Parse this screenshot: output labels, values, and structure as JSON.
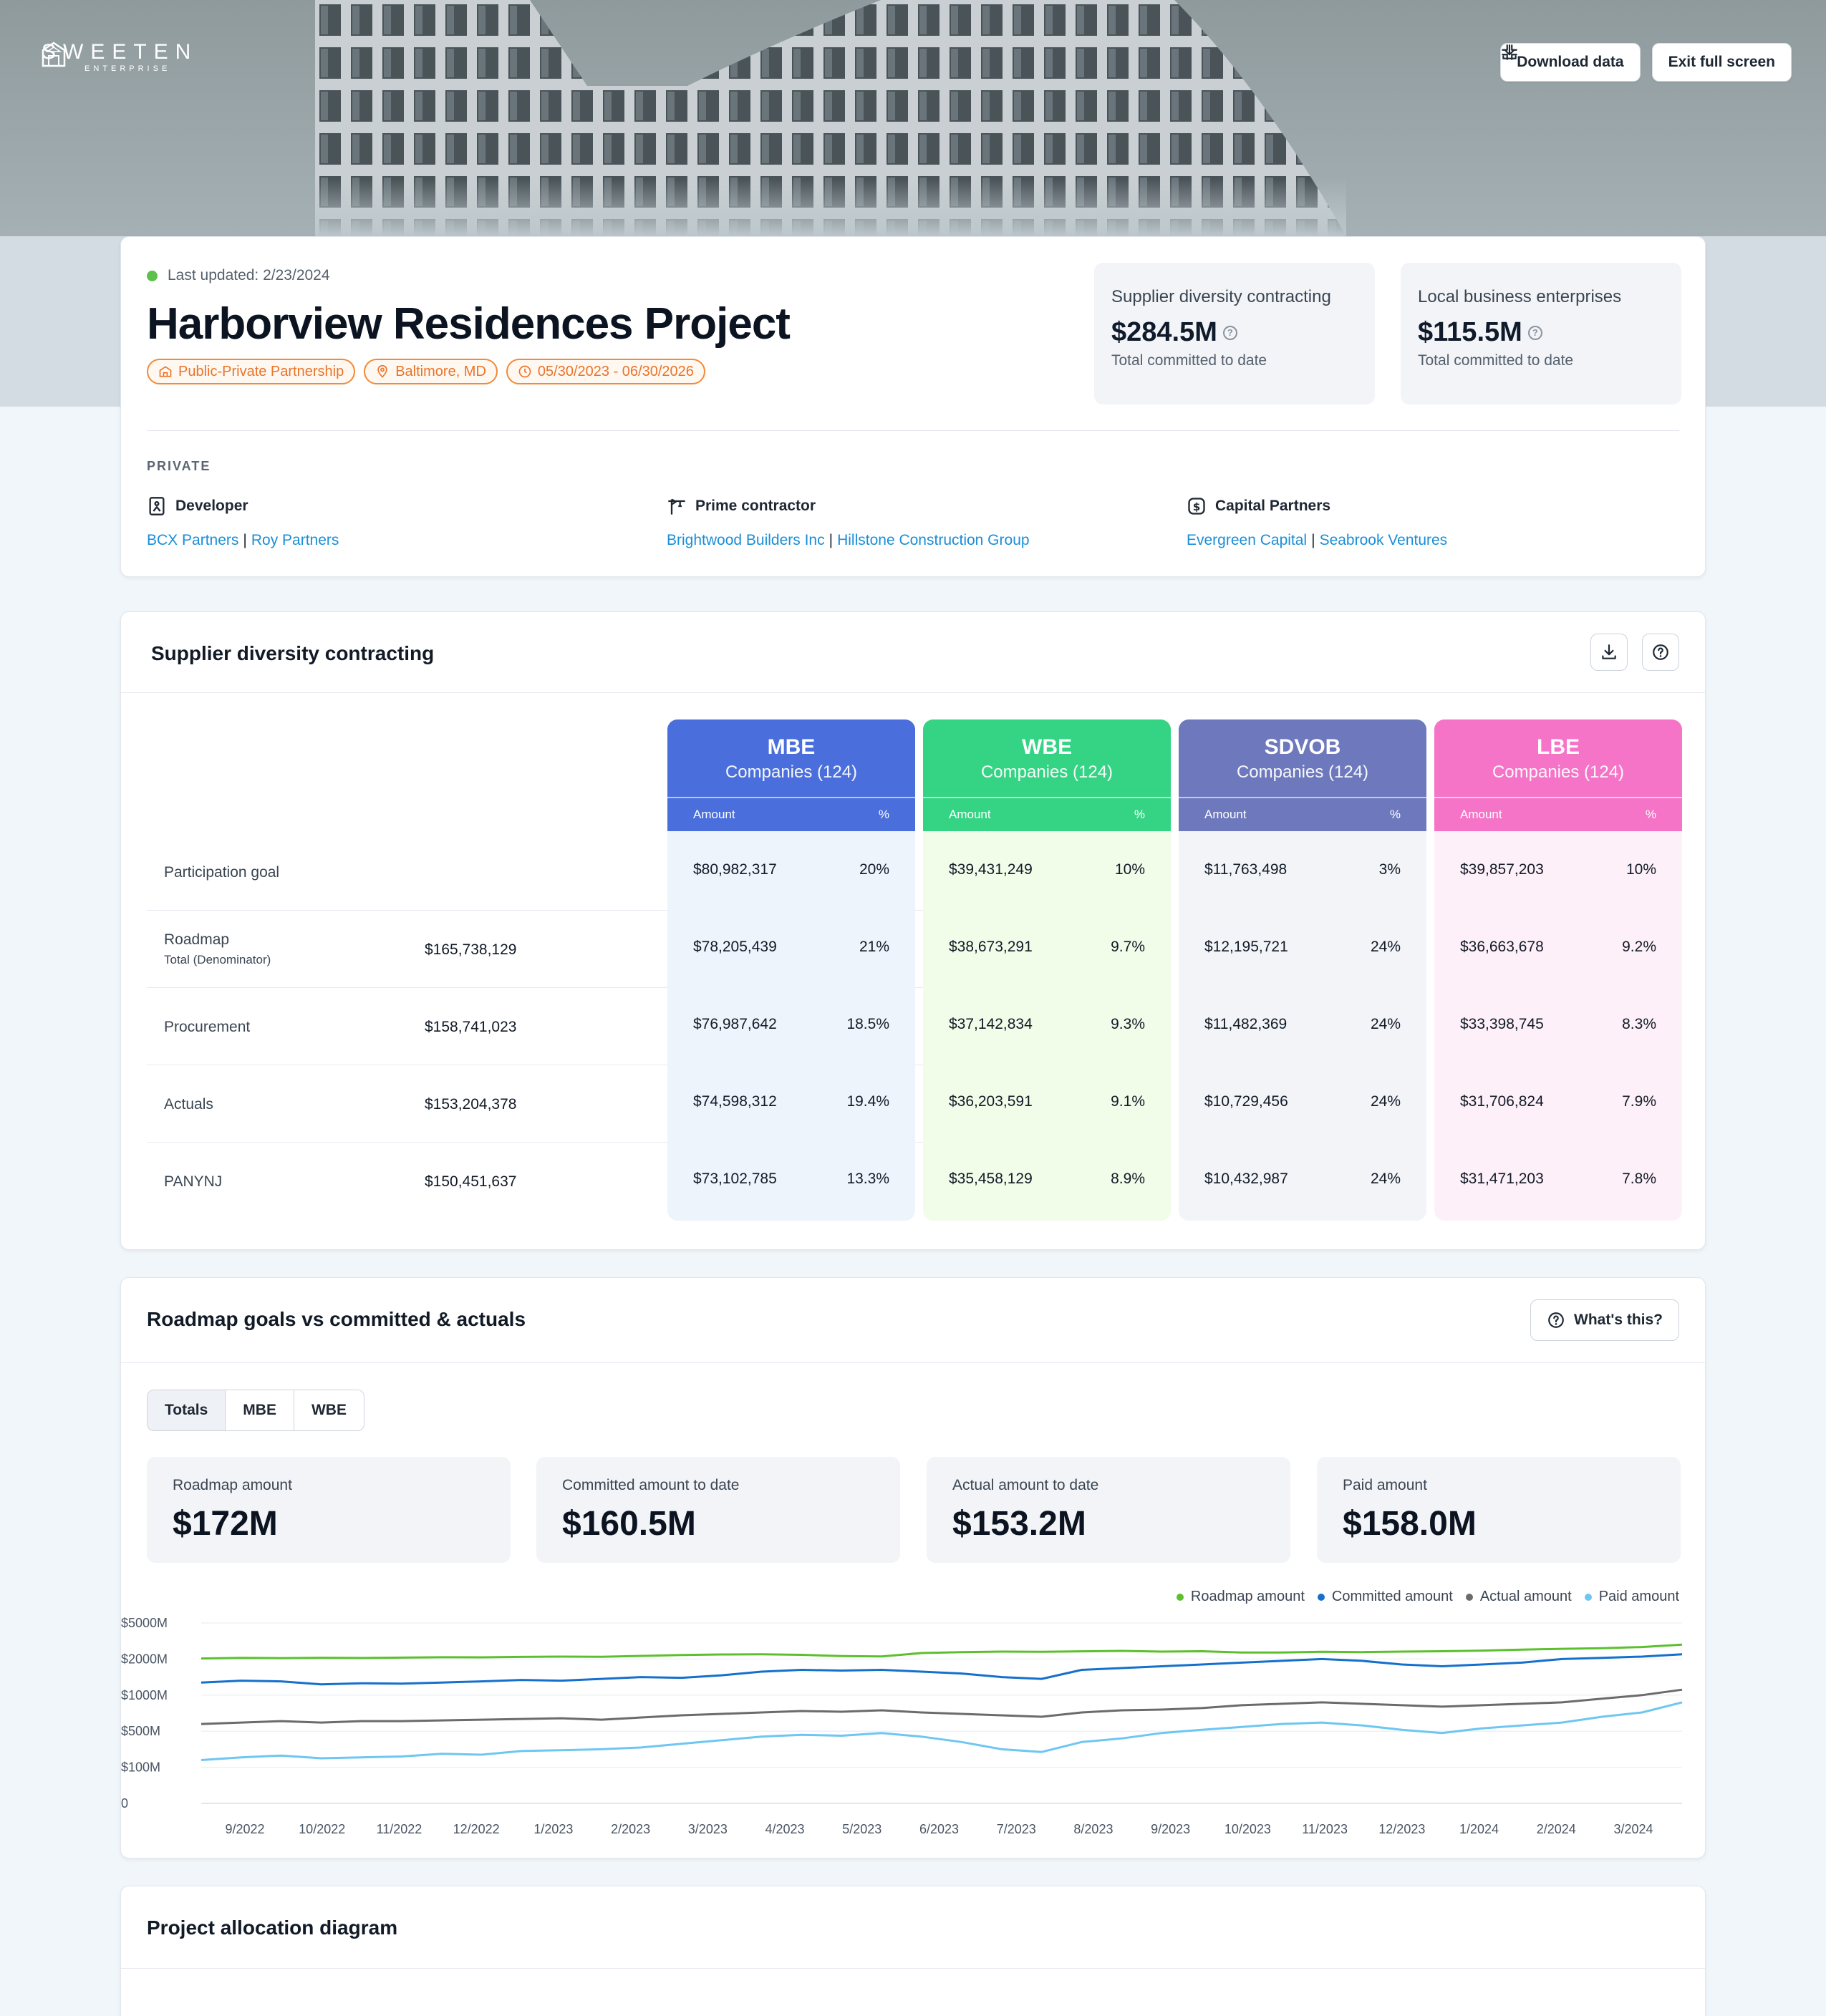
{
  "brand": {
    "name": "SWEETEN",
    "sub": "ENTERPRISE"
  },
  "hero_buttons": {
    "download": "Download data",
    "exit": "Exit full screen"
  },
  "project": {
    "last_updated": "Last updated: 2/23/2024",
    "title": "Harborview Residences Project",
    "tags": [
      "Public-Private Partnership",
      "Baltimore, MD",
      "05/30/2023 - 06/30/2026"
    ],
    "kpis": [
      {
        "label": "Supplier diversity contracting",
        "value": "$284.5M",
        "sub": "Total committed to date"
      },
      {
        "label": "Local business enterprises",
        "value": "$115.5M",
        "sub": "Total committed to date"
      }
    ],
    "private_label": "PRIVATE",
    "parties": [
      {
        "heading": "Developer",
        "links": [
          "BCX Partners",
          "Roy Partners"
        ]
      },
      {
        "heading": "Prime contractor",
        "links": [
          "Brightwood Builders Inc",
          "Hillstone Construction Group"
        ]
      },
      {
        "heading": "Capital Partners",
        "links": [
          "Evergreen Capital",
          "Seabrook Ventures"
        ]
      }
    ]
  },
  "supplier_diversity": {
    "title": "Supplier diversity contracting",
    "amount_label": "Amount",
    "pct_label": "%",
    "rows": [
      {
        "label": "Participation goal",
        "sublabel": "",
        "total": ""
      },
      {
        "label": "Roadmap",
        "sublabel": "Total (Denominator)",
        "total": "$165,738,129"
      },
      {
        "label": "Procurement",
        "sublabel": "",
        "total": "$158,741,023"
      },
      {
        "label": "Actuals",
        "sublabel": "",
        "total": "$153,204,378"
      },
      {
        "label": "PANYNJ",
        "sublabel": "",
        "total": "$150,451,637"
      }
    ],
    "categories": [
      {
        "name": "MBE",
        "companies": "Companies (124)",
        "color": "#4a6fdc",
        "body": "#eef4fc",
        "cells": [
          [
            "$80,982,317",
            "20%"
          ],
          [
            "$78,205,439",
            "21%"
          ],
          [
            "$76,987,642",
            "18.5%"
          ],
          [
            "$74,598,312",
            "19.4%"
          ],
          [
            "$73,102,785",
            "13.3%"
          ]
        ]
      },
      {
        "name": "WBE",
        "companies": "Companies (124)",
        "color": "#34d484",
        "body": "#f1fce9",
        "cells": [
          [
            "$39,431,249",
            "10%"
          ],
          [
            "$38,673,291",
            "9.7%"
          ],
          [
            "$37,142,834",
            "9.3%"
          ],
          [
            "$36,203,591",
            "9.1%"
          ],
          [
            "$35,458,129",
            "8.9%"
          ]
        ]
      },
      {
        "name": "SDVOB",
        "companies": "Companies (124)",
        "color": "#6e79bd",
        "body": "#f2f4f8",
        "cells": [
          [
            "$11,763,498",
            "3%"
          ],
          [
            "$12,195,721",
            "24%"
          ],
          [
            "$11,482,369",
            "24%"
          ],
          [
            "$10,729,456",
            "24%"
          ],
          [
            "$10,432,987",
            "24%"
          ]
        ]
      },
      {
        "name": "LBE",
        "companies": "Companies (124)",
        "color": "#f574c8",
        "body": "#fdf0f8",
        "cells": [
          [
            "$39,857,203",
            "10%"
          ],
          [
            "$36,663,678",
            "9.2%"
          ],
          [
            "$33,398,745",
            "8.3%"
          ],
          [
            "$31,706,824",
            "7.9%"
          ],
          [
            "$31,471,203",
            "7.8%"
          ]
        ]
      }
    ]
  },
  "roadmap": {
    "title": "Roadmap goals vs committed & actuals",
    "whats_this": "What's this?",
    "tabs": [
      "Totals",
      "MBE",
      "WBE"
    ],
    "active_tab": "Totals",
    "metrics": [
      {
        "label": "Roadmap amount",
        "value": "$172M"
      },
      {
        "label": "Committed amount to date",
        "value": "$160.5M"
      },
      {
        "label": "Actual amount to date",
        "value": "$153.2M"
      },
      {
        "label": "Paid amount",
        "value": "$158.0M"
      }
    ]
  },
  "chart_data": {
    "type": "line",
    "y_tick_labels": [
      "0",
      "$100M",
      "$500M",
      "$1000M",
      "$2000M",
      "$5000M"
    ],
    "y_tick_values": [
      0,
      100,
      500,
      1000,
      2000,
      5000
    ],
    "x_tick_labels": [
      "9/2022",
      "10/2022",
      "11/2022",
      "12/2022",
      "1/2023",
      "2/2023",
      "3/2023",
      "4/2023",
      "5/2023",
      "6/2023",
      "7/2023",
      "8/2023",
      "9/2023",
      "10/2023",
      "11/2023",
      "12/2023",
      "1/2024",
      "2/2024",
      "3/2024"
    ],
    "grid": true,
    "legend_position": "top-right",
    "series": [
      {
        "name": "Roadmap amount",
        "color": "#5cc02e",
        "values": [
          2050,
          2100,
          2080,
          2110,
          2090,
          2120,
          2150,
          2140,
          2180,
          2200,
          2190,
          2260,
          2340,
          2380,
          2400,
          2350,
          2250,
          2220,
          2500,
          2580,
          2620,
          2600,
          2640,
          2680,
          2620,
          2650,
          2550,
          2540,
          2600,
          2580,
          2620,
          2650,
          2700,
          2780,
          2850,
          2900,
          3000,
          3200
        ]
      },
      {
        "name": "Committed amount",
        "color": "#1570cc",
        "values": [
          1350,
          1400,
          1380,
          1300,
          1330,
          1320,
          1350,
          1380,
          1420,
          1400,
          1450,
          1500,
          1480,
          1550,
          1650,
          1700,
          1680,
          1700,
          1650,
          1600,
          1500,
          1450,
          1700,
          1750,
          1800,
          1850,
          1900,
          1950,
          2000,
          1950,
          1850,
          1800,
          1850,
          1900,
          2000,
          2100,
          2200,
          2400
        ]
      },
      {
        "name": "Actual amount",
        "color": "#6b6b6b",
        "values": [
          600,
          620,
          640,
          620,
          640,
          640,
          650,
          660,
          670,
          680,
          660,
          690,
          720,
          740,
          760,
          780,
          770,
          790,
          760,
          740,
          720,
          700,
          760,
          790,
          800,
          820,
          860,
          880,
          900,
          880,
          860,
          840,
          860,
          880,
          900,
          950,
          1000,
          1150
        ]
      },
      {
        "name": "Paid amount",
        "color": "#6ec6f2",
        "values": [
          180,
          210,
          230,
          200,
          210,
          220,
          250,
          240,
          280,
          290,
          300,
          320,
          360,
          400,
          440,
          460,
          450,
          480,
          440,
          380,
          300,
          270,
          380,
          420,
          480,
          520,
          560,
          600,
          620,
          580,
          520,
          480,
          540,
          580,
          620,
          700,
          760,
          900
        ]
      }
    ]
  },
  "allocation": {
    "title": "Project allocation diagram"
  }
}
